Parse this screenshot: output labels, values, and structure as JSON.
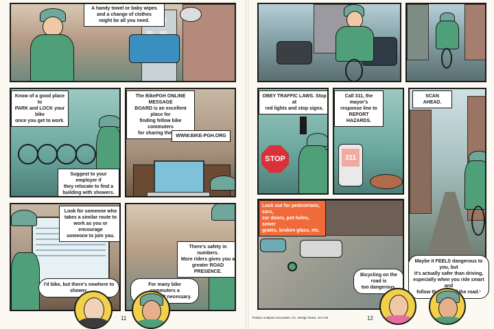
{
  "left_page": {
    "page_number": "11",
    "captions": {
      "towel": "A handy towel or baby wipes\nand a change of clothes\nmight be all you need.",
      "park": "Know of a good place to\nPARK and LOCK your bike\nonce you get to work.",
      "bikepgh": "The BikePGH ONLINE MESSAGE\nBOARD is an excellent place for\nfinding fellow bike commuters\nfor sharing the ride.",
      "url": "WWW.BIKE-PGH.ORG",
      "employer": "Suggest to your employer if\nthey relocate to find a\nbuilding with showers.",
      "similar_route": "Look for someone who\ntakes a similar route to\nwork as you or encourage\nsomeone to join you.",
      "safety": "There's safety in numbers.\nMore riders gives you a\ngreater ROAD PRESENCE."
    },
    "bubbles": {
      "no_shower": "I'd bike, but there's nowhere to shower.",
      "shower_not_necessary": "For many bike commuters a\nshower isn't necessary."
    }
  },
  "right_page": {
    "page_number": "12",
    "footnote": "¹Failure Analysis Associates, Inc. Design News, 10-4-93",
    "captions": {
      "traffic_laws": "OBEY TRAFFIC LAWS. Stop at\nred lights and stop signs.",
      "call_311": "Call 311, the mayor's\nresponse line to\nREPORT HAZARDS.",
      "scan_ahead": "SCAN AHEAD.",
      "look_out": "Look out for pedestrians, cars,\ncar doors, pot holes, sewer\ngrates, broken glass, etc."
    },
    "signs": {
      "stop": "STOP",
      "phone_number": "311"
    },
    "bubbles": {
      "too_dangerous": "Bicycling on the road is\ntoo dangerous.",
      "feels_dangerous": "Maybe it FEELS dangerous to you, but\nit's actually safer than driving,\nespecially when you ride smart and\nfollow the rules of the road.¹"
    }
  },
  "colors": {
    "ink": "#1a1a1a",
    "paper": "#fbf9f2",
    "shirt_green": "#4f9f78",
    "caption_orange": "#f06a3a",
    "stop_red": "#d9313a",
    "portrait_yellow": "#f2d04a"
  }
}
